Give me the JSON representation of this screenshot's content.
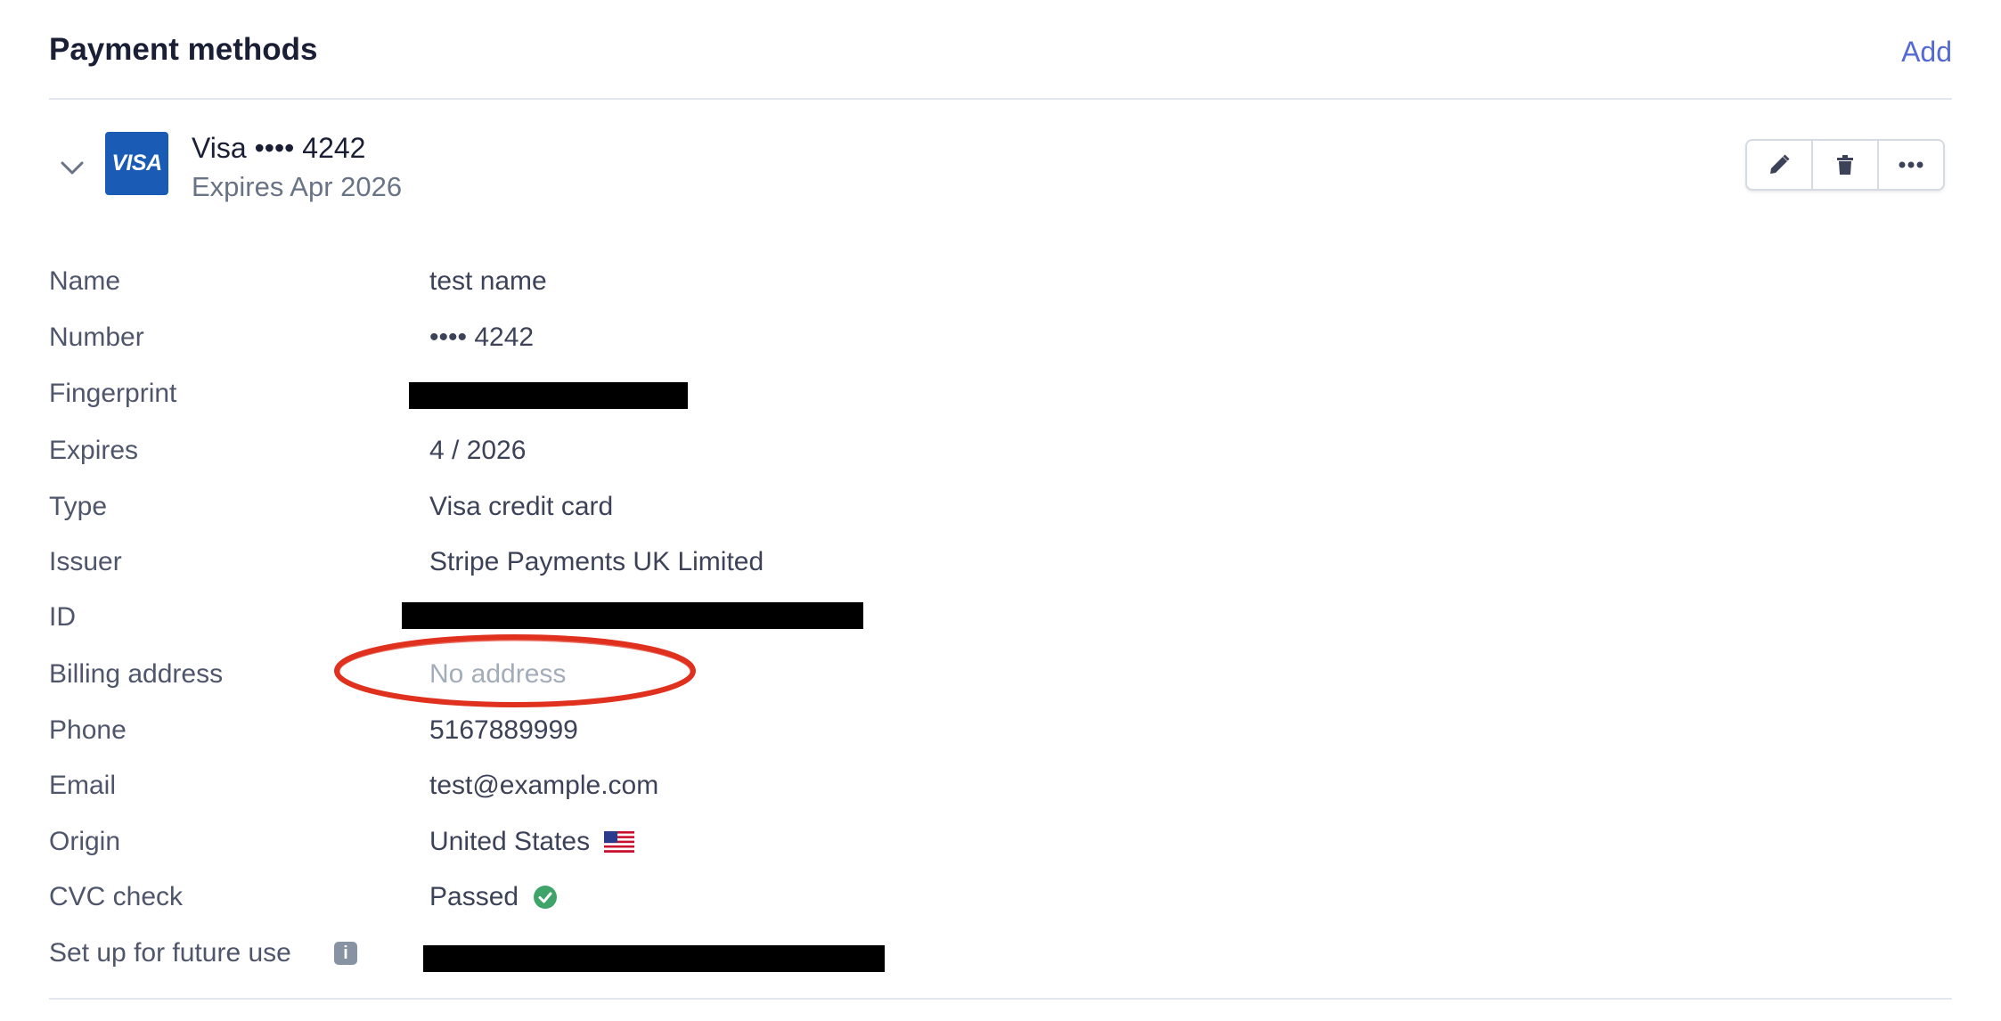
{
  "header": {
    "title": "Payment methods",
    "add_label": "Add"
  },
  "card": {
    "brand_logo_text": "VISA",
    "title": "Visa •••• 4242",
    "subtitle": "Expires Apr 2026",
    "brand_color": "#1a5bb5"
  },
  "actions": [
    "pencil-icon",
    "trash-icon",
    "more-icon"
  ],
  "details": {
    "name_label": "Name",
    "name_value": "test name",
    "number_label": "Number",
    "number_value": "•••• 4242",
    "fingerprint_label": "Fingerprint",
    "expires_label": "Expires",
    "expires_value": "4 / 2026",
    "type_label": "Type",
    "type_value": "Visa credit card",
    "issuer_label": "Issuer",
    "issuer_value": "Stripe Payments UK Limited",
    "id_label": "ID",
    "billing_label": "Billing address",
    "billing_value": "No address",
    "phone_label": "Phone",
    "phone_value": "5167889999",
    "email_label": "Email",
    "email_value": "test@example.com",
    "origin_label": "Origin",
    "origin_value": "United States",
    "cvc_label": "CVC check",
    "cvc_value": "Passed",
    "future_label": "Set up for future use"
  },
  "colors": {
    "link": "#5469d4",
    "success": "#3fa46a",
    "annotation": "#e0301e"
  }
}
